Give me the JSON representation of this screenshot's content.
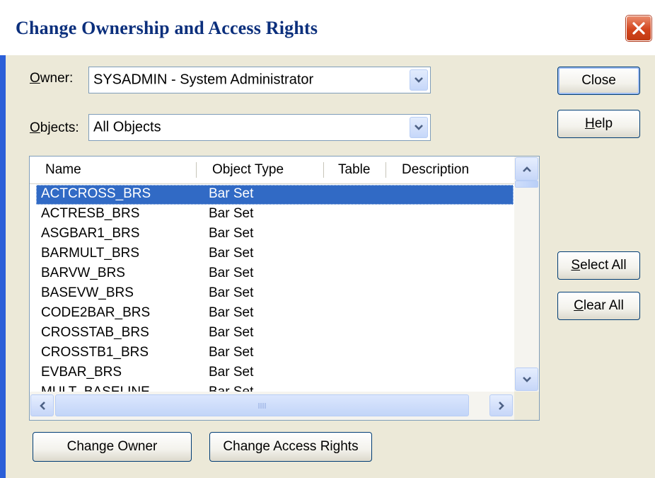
{
  "window": {
    "title": "Change Ownership and Access Rights",
    "close_icon": "close-icon"
  },
  "owner": {
    "label_u": "O",
    "label_rest": "wner:",
    "value": "SYSADMIN - System Administrator"
  },
  "objects": {
    "label_u": "O",
    "label_rest": "bjects:",
    "value": "All Objects"
  },
  "buttons": {
    "close": "Close",
    "help_u": "H",
    "help_rest": "elp",
    "select_all_u": "S",
    "select_all_rest": "elect All",
    "clear_all_u": "C",
    "clear_all_rest": "lear All",
    "change_owner": "Change Owner",
    "change_access_rights": "Change Access Rights"
  },
  "list": {
    "columns": [
      "Name",
      "Object Type",
      "Table",
      "Description"
    ],
    "rows": [
      {
        "name": "ACTCROSS_BRS",
        "type": "Bar Set",
        "selected": true
      },
      {
        "name": "ACTRESB_BRS",
        "type": "Bar Set"
      },
      {
        "name": "ASGBAR1_BRS",
        "type": "Bar Set"
      },
      {
        "name": "BARMULT_BRS",
        "type": "Bar Set"
      },
      {
        "name": "BARVW_BRS",
        "type": "Bar Set"
      },
      {
        "name": "BASEVW_BRS",
        "type": "Bar Set"
      },
      {
        "name": "CODE2BAR_BRS",
        "type": "Bar Set"
      },
      {
        "name": "CROSSTAB_BRS",
        "type": "Bar Set"
      },
      {
        "name": "CROSSTB1_BRS",
        "type": "Bar Set"
      },
      {
        "name": "EVBAR_BRS",
        "type": "Bar Set"
      },
      {
        "name": "MULT_BASELINE",
        "type": "Bar Set"
      }
    ]
  },
  "colors": {
    "title_text": "#0b2f7c",
    "selection": "#316ac5",
    "dialog_bg": "#ece9d8",
    "frame_blue": "#2b5fd8"
  }
}
